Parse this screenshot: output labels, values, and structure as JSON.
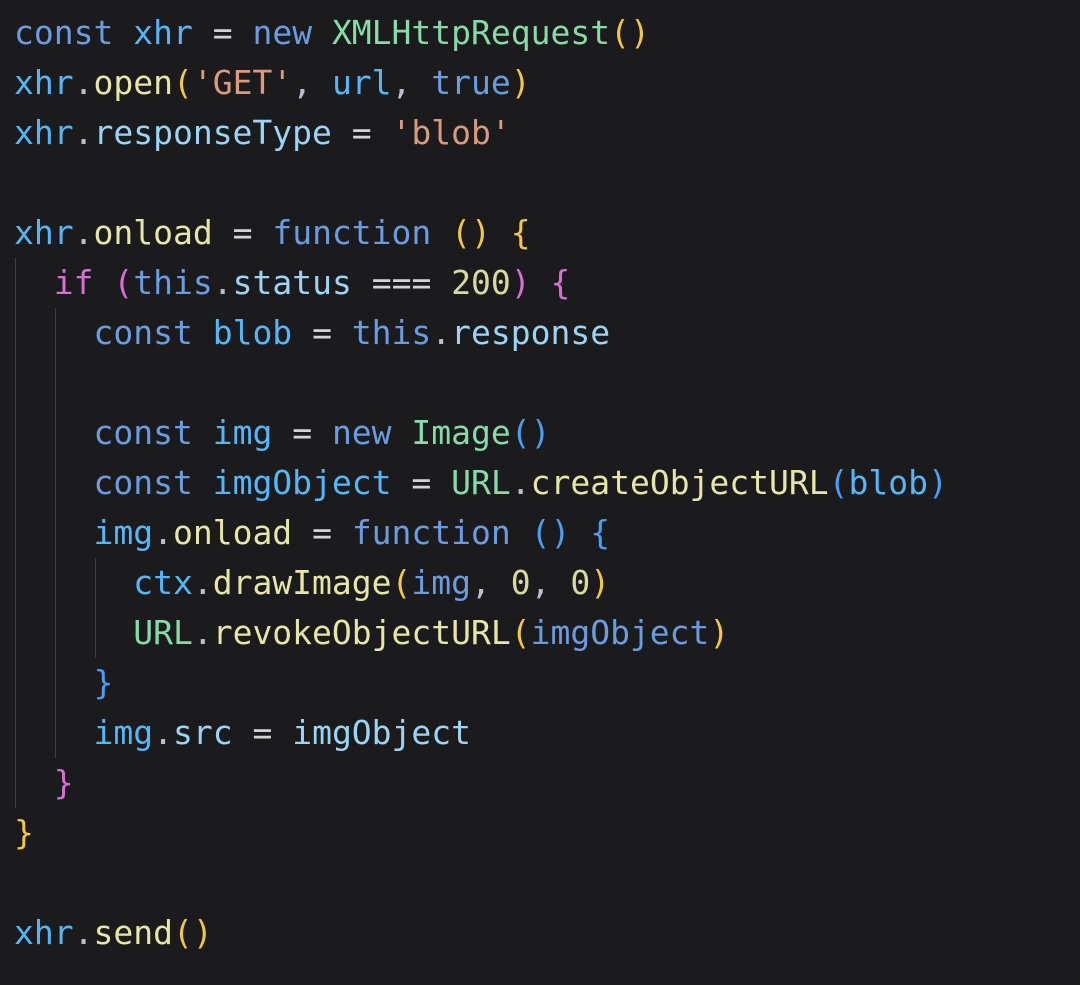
{
  "editor": {
    "name": "code-snippet-viewer",
    "language": "javascript",
    "background_color": "#1b1b1d",
    "font_size_px": 33,
    "line_height_px": 50,
    "indent_guide_color": "#3e3e42",
    "palette": {
      "keyword": "#6b9ce0",
      "variable": "#56b6f7",
      "property": "#9cd4f5",
      "function": "#e6e6a8",
      "class": "#86dba8",
      "string": "#d99a7f",
      "number": "#d7dba0",
      "operator": "#d4d4d4",
      "punctuation": "#b9c0cc",
      "bracket_level_1": "#f2c744",
      "bracket_level_2": "#d96fd6",
      "bracket_level_3": "#4b9ef5"
    }
  },
  "code": {
    "plain_text": "const xhr = new XMLHttpRequest()\nxhr.open('GET', url, true)\nxhr.responseType = 'blob'\n\nxhr.onload = function () {\n  if (this.status === 200) {\n    const blob = this.response\n\n    const img = new Image()\n    const imgObject = URL.createObjectURL(blob)\n    img.onload = function () {\n      ctx.drawImage(img, 0, 0)\n      URL.revokeObjectURL(imgObject)\n    }\n    img.src = imgObject\n  }\n}\n\nxhr.send()",
    "lines": [
      {
        "indent_guides": 0,
        "tokens": [
          {
            "text": "const",
            "kind": "keyword"
          },
          {
            "text": " ",
            "kind": "plain"
          },
          {
            "text": "xhr",
            "kind": "variable"
          },
          {
            "text": " ",
            "kind": "plain"
          },
          {
            "text": "=",
            "kind": "operator"
          },
          {
            "text": " ",
            "kind": "plain"
          },
          {
            "text": "new",
            "kind": "keyword"
          },
          {
            "text": " ",
            "kind": "plain"
          },
          {
            "text": "XMLHttpRequest",
            "kind": "class"
          },
          {
            "text": "(",
            "kind": "bracket1"
          },
          {
            "text": ")",
            "kind": "bracket1"
          }
        ]
      },
      {
        "indent_guides": 0,
        "tokens": [
          {
            "text": "xhr",
            "kind": "variable"
          },
          {
            "text": ".",
            "kind": "punctuation"
          },
          {
            "text": "open",
            "kind": "function"
          },
          {
            "text": "(",
            "kind": "bracket1"
          },
          {
            "text": "'GET'",
            "kind": "string"
          },
          {
            "text": ",",
            "kind": "punctuation"
          },
          {
            "text": " ",
            "kind": "plain"
          },
          {
            "text": "url",
            "kind": "variable"
          },
          {
            "text": ",",
            "kind": "punctuation"
          },
          {
            "text": " ",
            "kind": "plain"
          },
          {
            "text": "true",
            "kind": "keyword"
          },
          {
            "text": ")",
            "kind": "bracket1"
          }
        ]
      },
      {
        "indent_guides": 0,
        "tokens": [
          {
            "text": "xhr",
            "kind": "variable"
          },
          {
            "text": ".",
            "kind": "punctuation"
          },
          {
            "text": "responseType",
            "kind": "property"
          },
          {
            "text": " ",
            "kind": "plain"
          },
          {
            "text": "=",
            "kind": "operator"
          },
          {
            "text": " ",
            "kind": "plain"
          },
          {
            "text": "'blob'",
            "kind": "string"
          }
        ]
      },
      {
        "indent_guides": 0,
        "tokens": []
      },
      {
        "indent_guides": 0,
        "tokens": [
          {
            "text": "xhr",
            "kind": "variable"
          },
          {
            "text": ".",
            "kind": "punctuation"
          },
          {
            "text": "onload",
            "kind": "function"
          },
          {
            "text": " ",
            "kind": "plain"
          },
          {
            "text": "=",
            "kind": "operator"
          },
          {
            "text": " ",
            "kind": "plain"
          },
          {
            "text": "function",
            "kind": "keyword"
          },
          {
            "text": " ",
            "kind": "plain"
          },
          {
            "text": "(",
            "kind": "bracket1"
          },
          {
            "text": ")",
            "kind": "bracket1"
          },
          {
            "text": " ",
            "kind": "plain"
          },
          {
            "text": "{",
            "kind": "bracket1"
          }
        ]
      },
      {
        "indent_guides": 1,
        "tokens": [
          {
            "text": "  ",
            "kind": "plain"
          },
          {
            "text": "if",
            "kind": "bracket2"
          },
          {
            "text": " ",
            "kind": "plain"
          },
          {
            "text": "(",
            "kind": "bracket2"
          },
          {
            "text": "this",
            "kind": "keyword"
          },
          {
            "text": ".",
            "kind": "punctuation"
          },
          {
            "text": "status",
            "kind": "property"
          },
          {
            "text": " ",
            "kind": "plain"
          },
          {
            "text": "===",
            "kind": "operator"
          },
          {
            "text": " ",
            "kind": "plain"
          },
          {
            "text": "200",
            "kind": "number"
          },
          {
            "text": ")",
            "kind": "bracket2"
          },
          {
            "text": " ",
            "kind": "plain"
          },
          {
            "text": "{",
            "kind": "bracket2"
          }
        ]
      },
      {
        "indent_guides": 2,
        "tokens": [
          {
            "text": "    ",
            "kind": "plain"
          },
          {
            "text": "const",
            "kind": "keyword"
          },
          {
            "text": " ",
            "kind": "plain"
          },
          {
            "text": "blob",
            "kind": "variable"
          },
          {
            "text": " ",
            "kind": "plain"
          },
          {
            "text": "=",
            "kind": "operator"
          },
          {
            "text": " ",
            "kind": "plain"
          },
          {
            "text": "this",
            "kind": "keyword"
          },
          {
            "text": ".",
            "kind": "punctuation"
          },
          {
            "text": "response",
            "kind": "property"
          }
        ]
      },
      {
        "indent_guides": 2,
        "tokens": []
      },
      {
        "indent_guides": 2,
        "tokens": [
          {
            "text": "    ",
            "kind": "plain"
          },
          {
            "text": "const",
            "kind": "keyword"
          },
          {
            "text": " ",
            "kind": "plain"
          },
          {
            "text": "img",
            "kind": "variable"
          },
          {
            "text": " ",
            "kind": "plain"
          },
          {
            "text": "=",
            "kind": "operator"
          },
          {
            "text": " ",
            "kind": "plain"
          },
          {
            "text": "new",
            "kind": "keyword"
          },
          {
            "text": " ",
            "kind": "plain"
          },
          {
            "text": "Image",
            "kind": "class"
          },
          {
            "text": "(",
            "kind": "bracket3"
          },
          {
            "text": ")",
            "kind": "bracket3"
          }
        ]
      },
      {
        "indent_guides": 2,
        "tokens": [
          {
            "text": "    ",
            "kind": "plain"
          },
          {
            "text": "const",
            "kind": "keyword"
          },
          {
            "text": " ",
            "kind": "plain"
          },
          {
            "text": "imgObject",
            "kind": "variable"
          },
          {
            "text": " ",
            "kind": "plain"
          },
          {
            "text": "=",
            "kind": "operator"
          },
          {
            "text": " ",
            "kind": "plain"
          },
          {
            "text": "URL",
            "kind": "class"
          },
          {
            "text": ".",
            "kind": "punctuation"
          },
          {
            "text": "createObjectURL",
            "kind": "function"
          },
          {
            "text": "(",
            "kind": "bracket3"
          },
          {
            "text": "blob",
            "kind": "variable"
          },
          {
            "text": ")",
            "kind": "bracket3"
          }
        ]
      },
      {
        "indent_guides": 2,
        "tokens": [
          {
            "text": "    ",
            "kind": "plain"
          },
          {
            "text": "img",
            "kind": "variable"
          },
          {
            "text": ".",
            "kind": "punctuation"
          },
          {
            "text": "onload",
            "kind": "function"
          },
          {
            "text": " ",
            "kind": "plain"
          },
          {
            "text": "=",
            "kind": "operator"
          },
          {
            "text": " ",
            "kind": "plain"
          },
          {
            "text": "function",
            "kind": "keyword"
          },
          {
            "text": " ",
            "kind": "plain"
          },
          {
            "text": "(",
            "kind": "bracket3"
          },
          {
            "text": ")",
            "kind": "bracket3"
          },
          {
            "text": " ",
            "kind": "plain"
          },
          {
            "text": "{",
            "kind": "bracket3"
          }
        ]
      },
      {
        "indent_guides": 3,
        "tokens": [
          {
            "text": "      ",
            "kind": "plain"
          },
          {
            "text": "ctx",
            "kind": "variable"
          },
          {
            "text": ".",
            "kind": "punctuation"
          },
          {
            "text": "drawImage",
            "kind": "function"
          },
          {
            "text": "(",
            "kind": "bracket1"
          },
          {
            "text": "img",
            "kind": "keyword"
          },
          {
            "text": ",",
            "kind": "punctuation"
          },
          {
            "text": " ",
            "kind": "plain"
          },
          {
            "text": "0",
            "kind": "number"
          },
          {
            "text": ",",
            "kind": "punctuation"
          },
          {
            "text": " ",
            "kind": "plain"
          },
          {
            "text": "0",
            "kind": "number"
          },
          {
            "text": ")",
            "kind": "bracket1"
          }
        ]
      },
      {
        "indent_guides": 3,
        "tokens": [
          {
            "text": "      ",
            "kind": "plain"
          },
          {
            "text": "URL",
            "kind": "class"
          },
          {
            "text": ".",
            "kind": "punctuation"
          },
          {
            "text": "revokeObjectURL",
            "kind": "function"
          },
          {
            "text": "(",
            "kind": "bracket1"
          },
          {
            "text": "imgObject",
            "kind": "keyword"
          },
          {
            "text": ")",
            "kind": "bracket1"
          }
        ]
      },
      {
        "indent_guides": 2,
        "tokens": [
          {
            "text": "    ",
            "kind": "plain"
          },
          {
            "text": "}",
            "kind": "bracket3"
          }
        ]
      },
      {
        "indent_guides": 2,
        "tokens": [
          {
            "text": "    ",
            "kind": "plain"
          },
          {
            "text": "img",
            "kind": "variable"
          },
          {
            "text": ".",
            "kind": "punctuation"
          },
          {
            "text": "src",
            "kind": "property"
          },
          {
            "text": " ",
            "kind": "plain"
          },
          {
            "text": "=",
            "kind": "operator"
          },
          {
            "text": " ",
            "kind": "plain"
          },
          {
            "text": "imgObject",
            "kind": "property"
          }
        ]
      },
      {
        "indent_guides": 1,
        "tokens": [
          {
            "text": "  ",
            "kind": "plain"
          },
          {
            "text": "}",
            "kind": "bracket2"
          }
        ]
      },
      {
        "indent_guides": 0,
        "tokens": [
          {
            "text": "}",
            "kind": "bracket1"
          }
        ]
      },
      {
        "indent_guides": 0,
        "tokens": []
      },
      {
        "indent_guides": 0,
        "tokens": [
          {
            "text": "xhr",
            "kind": "variable"
          },
          {
            "text": ".",
            "kind": "punctuation"
          },
          {
            "text": "send",
            "kind": "function"
          },
          {
            "text": "(",
            "kind": "bracket1"
          },
          {
            "text": ")",
            "kind": "bracket1"
          }
        ]
      }
    ]
  }
}
